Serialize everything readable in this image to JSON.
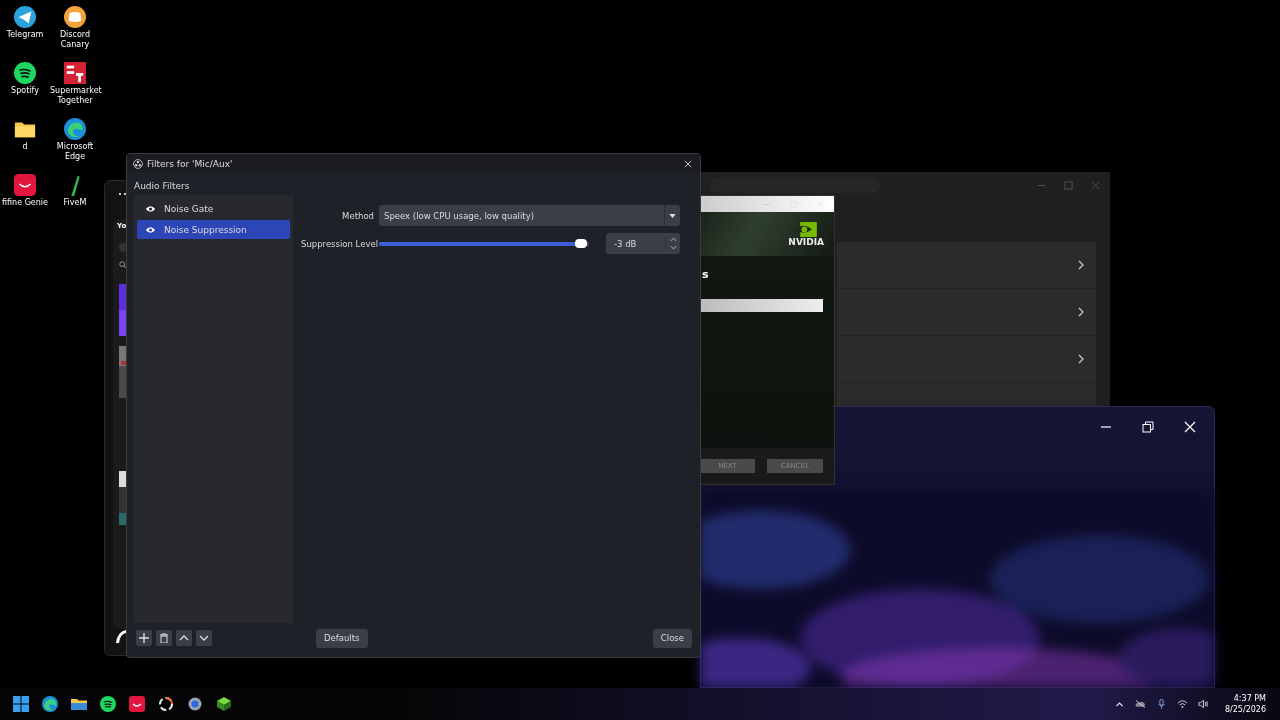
{
  "desktop_icons": [
    {
      "label": "Telegram"
    },
    {
      "label": "Spotify"
    },
    {
      "label": "d"
    },
    {
      "label": "fifine Genie"
    },
    {
      "label": "Discord Canary"
    },
    {
      "label": "Supermarket Together"
    },
    {
      "label": "Microsoft Edge"
    },
    {
      "label": "FiveM"
    }
  ],
  "music_window": {
    "heading": "Yo"
  },
  "installer_window": {
    "logo": "NVIDIA",
    "heading": "s",
    "buttons": [
      {
        "label": "NEXT",
        "disabled": true
      },
      {
        "label": "CANCEL",
        "disabled": true
      }
    ]
  },
  "filters_dialog": {
    "title": "Filters for 'Mic/Aux'",
    "section": "Audio Filters",
    "filters": [
      {
        "name": "Noise Gate",
        "visible": true,
        "selected": false
      },
      {
        "name": "Noise Suppression",
        "visible": true,
        "selected": true
      }
    ],
    "method": {
      "label": "Method",
      "value": "Speex (low CPU usage, low quality)"
    },
    "suppression": {
      "label": "Suppression Level",
      "level": 0.96,
      "value": "-3 dB"
    },
    "defaults_button": "Defaults",
    "close_button": "Close"
  },
  "taskbar": {
    "time": "4:37 PM",
    "date": "8/25/2026"
  }
}
